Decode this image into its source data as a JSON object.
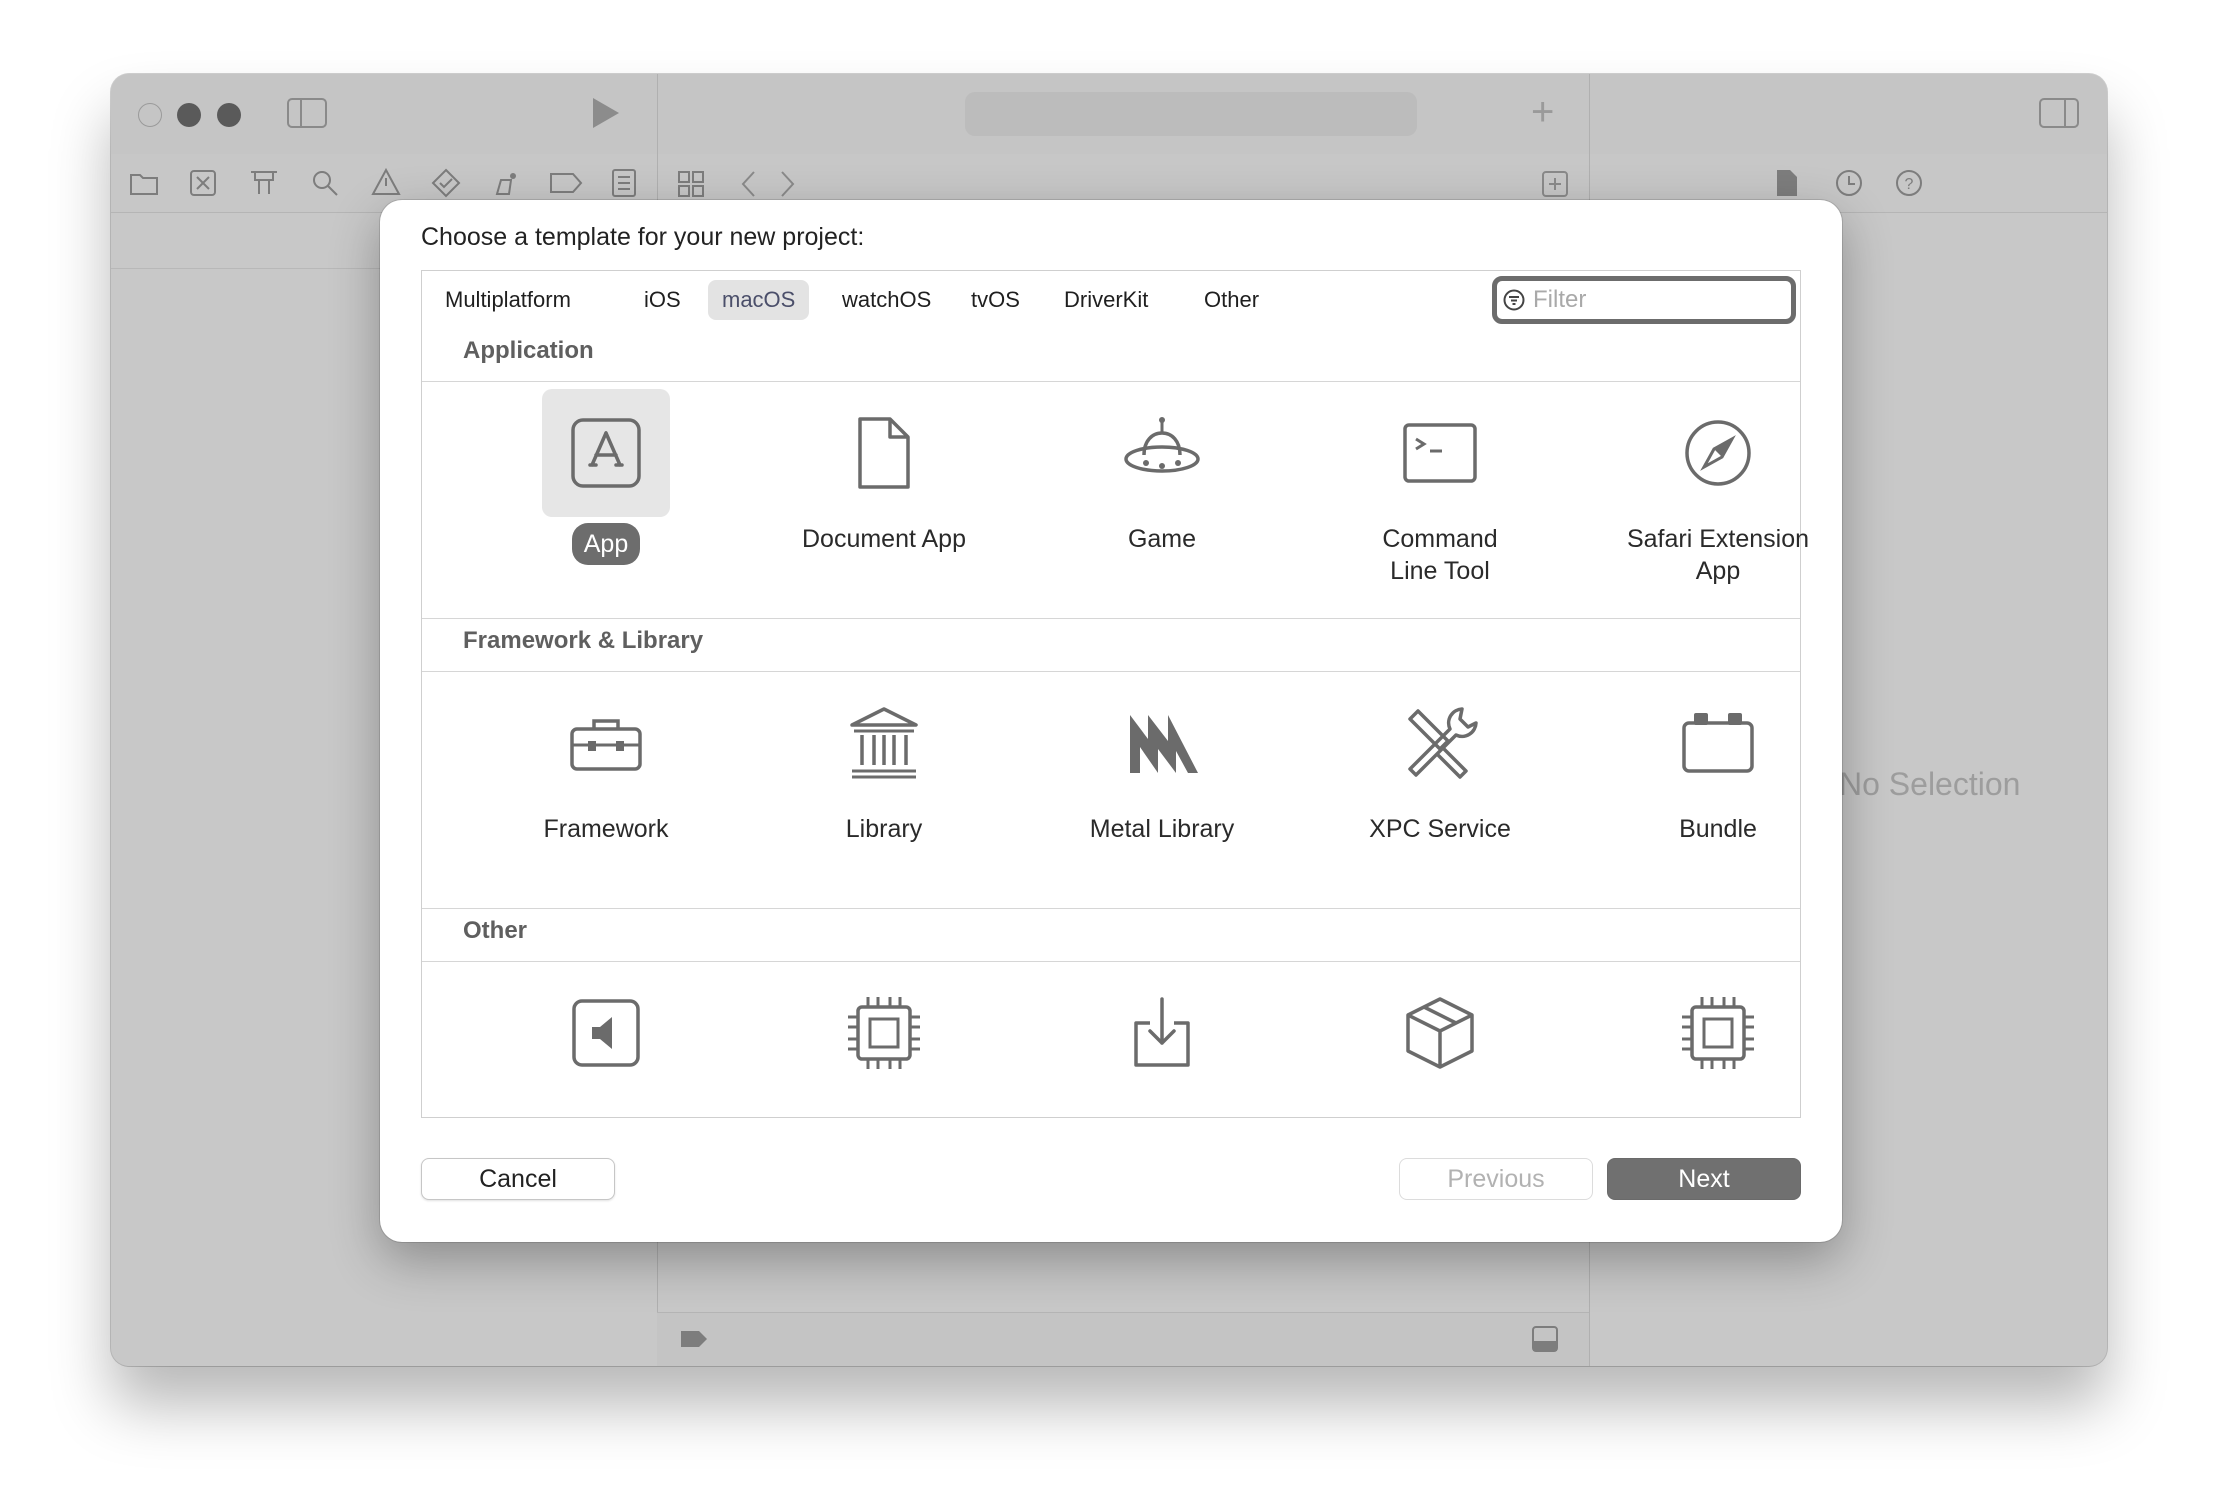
{
  "dialog": {
    "title": "Choose a template for your new project:",
    "tabs": [
      {
        "label": "Multiplatform"
      },
      {
        "label": "iOS"
      },
      {
        "label": "macOS",
        "selected": true
      },
      {
        "label": "watchOS"
      },
      {
        "label": "tvOS"
      },
      {
        "label": "DriverKit"
      },
      {
        "label": "Other"
      }
    ],
    "filter": {
      "placeholder": "Filter",
      "value": ""
    },
    "sections": [
      {
        "title": "Application",
        "items": [
          {
            "label": "App",
            "icon": "app-store-icon",
            "selected": true
          },
          {
            "label": "Document App",
            "icon": "document-icon"
          },
          {
            "label": "Game",
            "icon": "game-ufo-icon"
          },
          {
            "label": "Command\nLine Tool",
            "icon": "terminal-icon"
          },
          {
            "label": "Safari Extension\nApp",
            "icon": "safari-compass-icon"
          }
        ]
      },
      {
        "title": "Framework & Library",
        "items": [
          {
            "label": "Framework",
            "icon": "toolbox-icon"
          },
          {
            "label": "Library",
            "icon": "library-building-icon"
          },
          {
            "label": "Metal Library",
            "icon": "metal-icon"
          },
          {
            "label": "XPC Service",
            "icon": "tools-icon"
          },
          {
            "label": "Bundle",
            "icon": "bundle-icon"
          }
        ]
      },
      {
        "title": "Other",
        "items": [
          {
            "label": "",
            "icon": "speaker-icon"
          },
          {
            "label": "",
            "icon": "chip-icon"
          },
          {
            "label": "",
            "icon": "download-icon"
          },
          {
            "label": "",
            "icon": "package-box-icon"
          },
          {
            "label": "",
            "icon": "chip-icon"
          }
        ]
      }
    ],
    "buttons": {
      "cancel": "Cancel",
      "previous": "Previous",
      "next": "Next"
    }
  },
  "background_window": {
    "right_pane_text": "No Selection"
  },
  "colors": {
    "selected_label_bg": "#6d6d6d",
    "next_button_bg": "#707070",
    "selected_tab_text": "#4b4f6a",
    "dimmed_window": "#c8c8c8"
  }
}
